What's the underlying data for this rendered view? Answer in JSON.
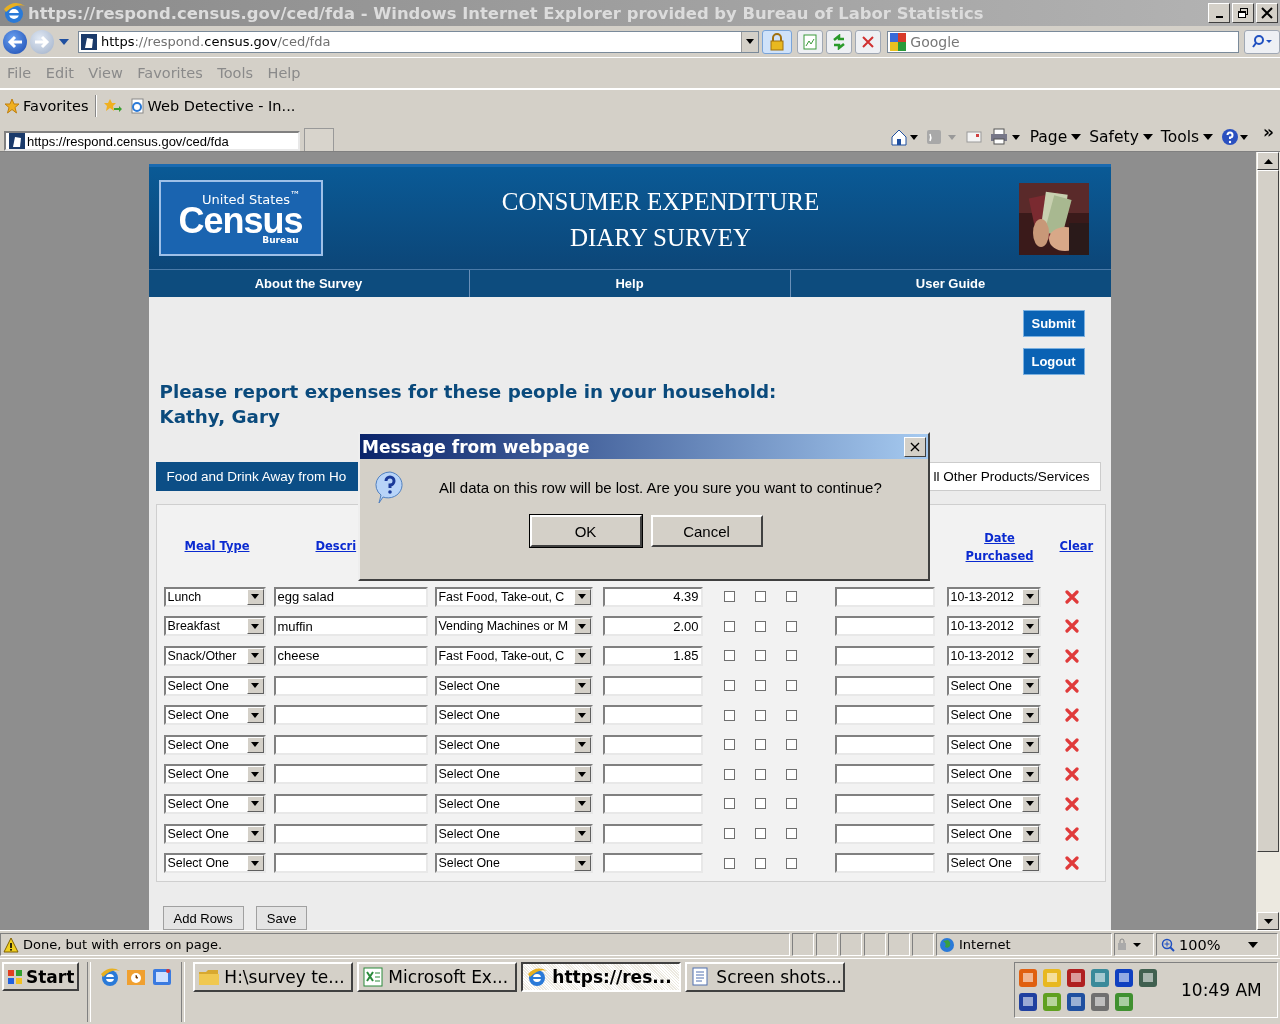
{
  "window": {
    "title": "https://respond.census.gov/ced/fda - Windows Internet Explorer provided by Bureau of Labor Statistics"
  },
  "address_bar": {
    "url_start": "https",
    "url_mid": "://respond.",
    "url_host": "census.gov",
    "url_end": "/ced/fda"
  },
  "search": {
    "placeholder": "Google"
  },
  "menu": [
    "File",
    "Edit",
    "View",
    "Favorites",
    "Tools",
    "Help"
  ],
  "favorites_bar": {
    "label": "Favorites",
    "items": [
      "Web Detective - In..."
    ]
  },
  "browser_tabs": [
    {
      "label": "https://respond.census.gov/ced/fda",
      "selected": true
    }
  ],
  "command_bar": {
    "menus": [
      "Page",
      "Safety",
      "Tools"
    ],
    "overflow": "»"
  },
  "page": {
    "logo": {
      "top": "United States$^{™}$",
      "name": "Census",
      "bottom": "Bureau"
    },
    "title_lines": [
      "CONSUMER EXPENDITURE",
      "DIARY SURVEY"
    ],
    "nav": [
      "About the Survey",
      "Help",
      "User Guide"
    ],
    "buttons": [
      "Submit",
      "Logout"
    ],
    "heading": "Please report expenses for these people in your household:",
    "people": "Kathy, Gary",
    "tabs": [
      {
        "label": "Food and Drink Away from Ho",
        "selected": true
      },
      {
        "label": "ll Other Products/Services",
        "selected": false
      }
    ],
    "columns": [
      "Meal Type",
      "Descri",
      "Date Purchased",
      "Clear"
    ],
    "rows": [
      {
        "meal": "Lunch",
        "description": "egg salad",
        "category": "Fast Food, Take-out, C",
        "amount": "4.39",
        "date": "10-13-2012",
        "checkboxes": [
          {
            "checked": false
          },
          {
            "checked": false
          },
          {
            "checked": false
          }
        ]
      },
      {
        "meal": "Breakfast",
        "description": "muffin",
        "category": "Vending Machines or M",
        "amount": "2.00",
        "date": "10-13-2012",
        "checkboxes": [
          {
            "checked": false
          },
          {
            "checked": false
          },
          {
            "checked": false
          }
        ]
      },
      {
        "meal": "Snack/Other",
        "description": "cheese",
        "category": "Fast Food, Take-out, C",
        "amount": "1.85",
        "date": "10-13-2012",
        "checkboxes": [
          {
            "checked": false
          },
          {
            "checked": false
          },
          {
            "checked": false
          }
        ]
      },
      {
        "meal": "Select One",
        "category": "Select One",
        "date": "Select One",
        "checkboxes": [
          {
            "checked": false
          },
          {
            "checked": false
          },
          {
            "checked": false
          }
        ]
      },
      {
        "meal": "Select One",
        "category": "Select One",
        "date": "Select One",
        "checkboxes": [
          {
            "checked": false
          },
          {
            "checked": false
          },
          {
            "checked": false
          }
        ]
      },
      {
        "meal": "Select One",
        "category": "Select One",
        "date": "Select One",
        "checkboxes": [
          {
            "checked": false
          },
          {
            "checked": false
          },
          {
            "checked": false
          }
        ]
      },
      {
        "meal": "Select One",
        "category": "Select One",
        "date": "Select One",
        "checkboxes": [
          {
            "checked": false
          },
          {
            "checked": false
          },
          {
            "checked": false
          }
        ]
      },
      {
        "meal": "Select One",
        "category": "Select One",
        "date": "Select One",
        "checkboxes": [
          {
            "checked": false
          },
          {
            "checked": false
          },
          {
            "checked": false
          }
        ]
      },
      {
        "meal": "Select One",
        "category": "Select One",
        "date": "Select One",
        "checkboxes": [
          {
            "checked": false
          },
          {
            "checked": false
          },
          {
            "checked": false
          }
        ]
      },
      {
        "meal": "Select One",
        "category": "Select One",
        "date": "Select One",
        "checkboxes": [
          {
            "checked": false
          },
          {
            "checked": false
          },
          {
            "checked": false
          }
        ]
      }
    ],
    "form_buttons": [
      "Add Rows",
      "Save"
    ]
  },
  "dialog": {
    "title": "Message from webpage",
    "close": "×",
    "message": "All data on this row will be lost. Are you sure you want to continue?",
    "buttons": [
      "OK",
      "Cancel"
    ]
  },
  "status_bar": {
    "text": "Done, but with errors on page.",
    "zone": "Internet",
    "zoom": "100%"
  },
  "taskbar": {
    "start": "Start",
    "tasks": [
      {
        "kind": "folder",
        "label": "H:\\survey te...",
        "selected": false
      },
      {
        "kind": "excel",
        "label": "Microsoft Ex...",
        "selected": false
      },
      {
        "kind": "browser",
        "label": "https://res...",
        "selected": true
      },
      {
        "kind": "document",
        "label": "Screen shots...",
        "selected": false
      }
    ],
    "clock": "10:49 AM"
  }
}
